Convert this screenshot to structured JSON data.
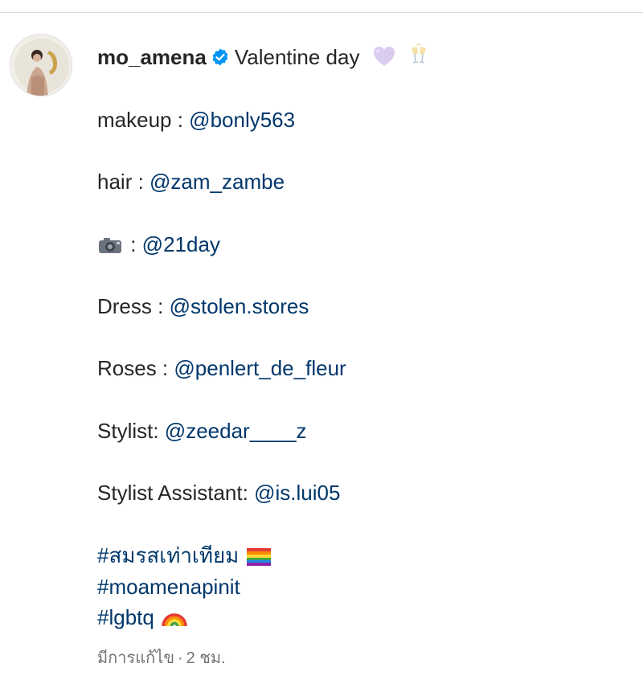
{
  "post": {
    "username": "mo_amena",
    "title_text": "Valentine day",
    "credits": [
      {
        "label": "makeup : ",
        "mention": "@bonly563"
      },
      {
        "label": "hair : ",
        "mention": "@zam_zambe"
      },
      {
        "label": " : ",
        "mention": "@21day",
        "icon": "camera-icon"
      },
      {
        "label": "Dress : ",
        "mention": "@stolen.stores"
      },
      {
        "label": "Roses : ",
        "mention": "@penlert_de_fleur"
      },
      {
        "label": "Stylist: ",
        "mention": "@zeedar____z"
      },
      {
        "label": "Stylist Assistant: ",
        "mention": "@is.lui05"
      }
    ],
    "hashtags": [
      "#สมรสเท่าเทียม",
      "#moamenapinit",
      "#lgbtq"
    ],
    "edited_label": "มีการแก้ไข",
    "separator": "·",
    "time_ago": "2 ชม.",
    "icons": {
      "verified": "verified-badge-icon",
      "heart": "purple-heart-emoji",
      "cheers": "clinking-glasses-emoji",
      "camera": "camera-emoji",
      "rainbow_flag": "rainbow-flag-emoji",
      "rainbow": "rainbow-emoji"
    },
    "colors": {
      "link": "#00376b",
      "text": "#262626",
      "muted": "#737373",
      "verified": "#0095f6"
    }
  }
}
